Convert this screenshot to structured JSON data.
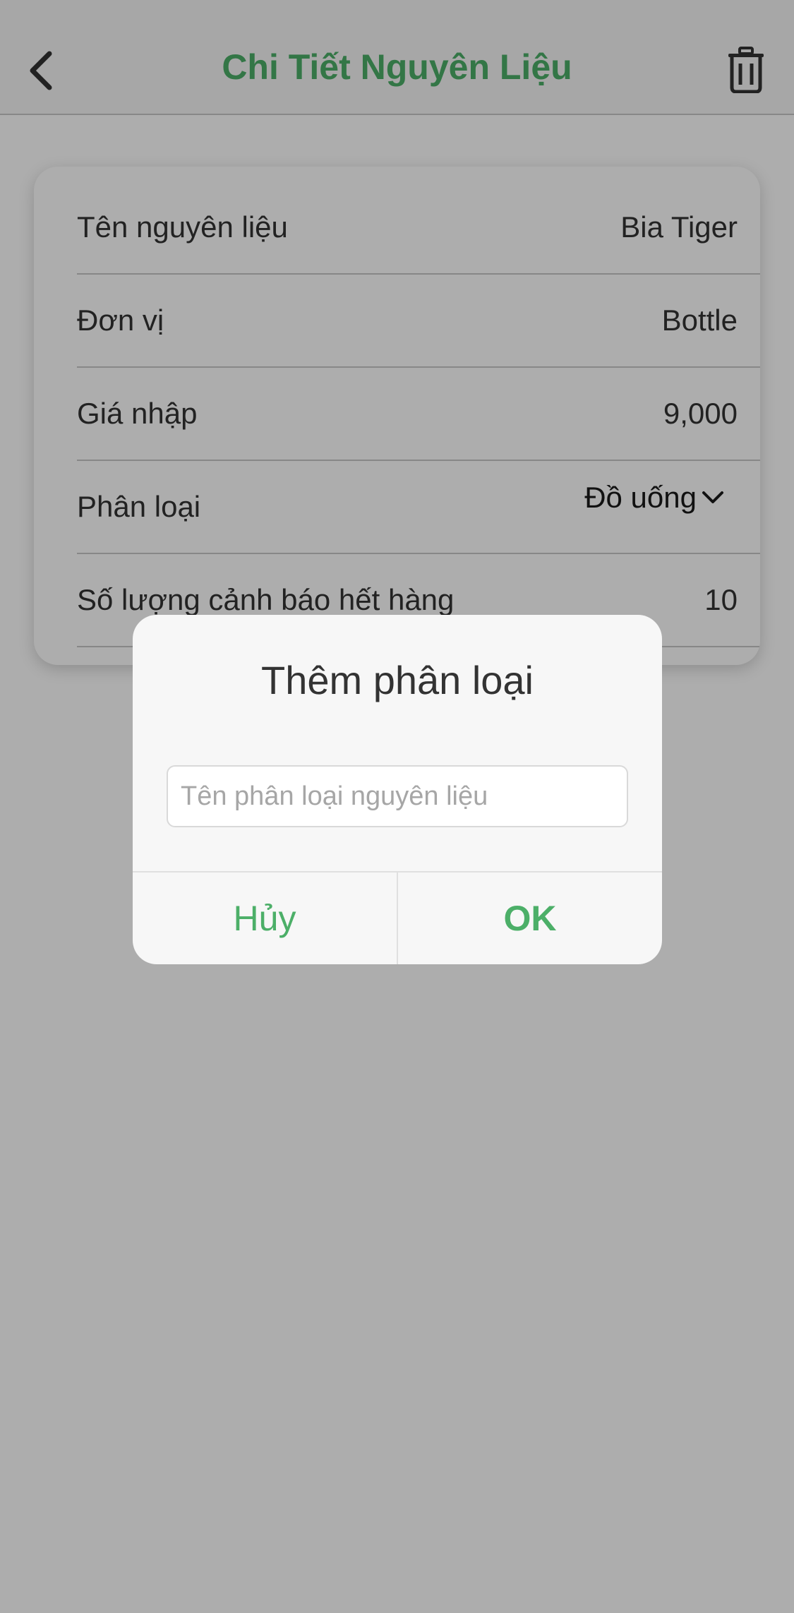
{
  "header": {
    "title": "Chi Tiết Nguyên Liệu",
    "back_icon": "chevron-left-icon",
    "delete_icon": "trash-icon"
  },
  "details": {
    "rows": [
      {
        "label": "Tên nguyên liệu",
        "value": "Bia Tiger"
      },
      {
        "label": "Đơn vị",
        "value": "Bottle"
      },
      {
        "label": "Giá nhập",
        "value": "9,000"
      },
      {
        "label": "Phân loại",
        "value": "Đồ uống"
      },
      {
        "label": "Số lượng cảnh báo hết hàng",
        "value": "10"
      }
    ]
  },
  "dialog": {
    "title": "Thêm phân loại",
    "input_value": "",
    "input_placeholder": "Tên phân loại nguyên liệu",
    "cancel_label": "Hủy",
    "ok_label": "OK"
  },
  "colors": {
    "accent": "#4caf68",
    "overlay": "rgba(0,0,0,0.32)"
  }
}
